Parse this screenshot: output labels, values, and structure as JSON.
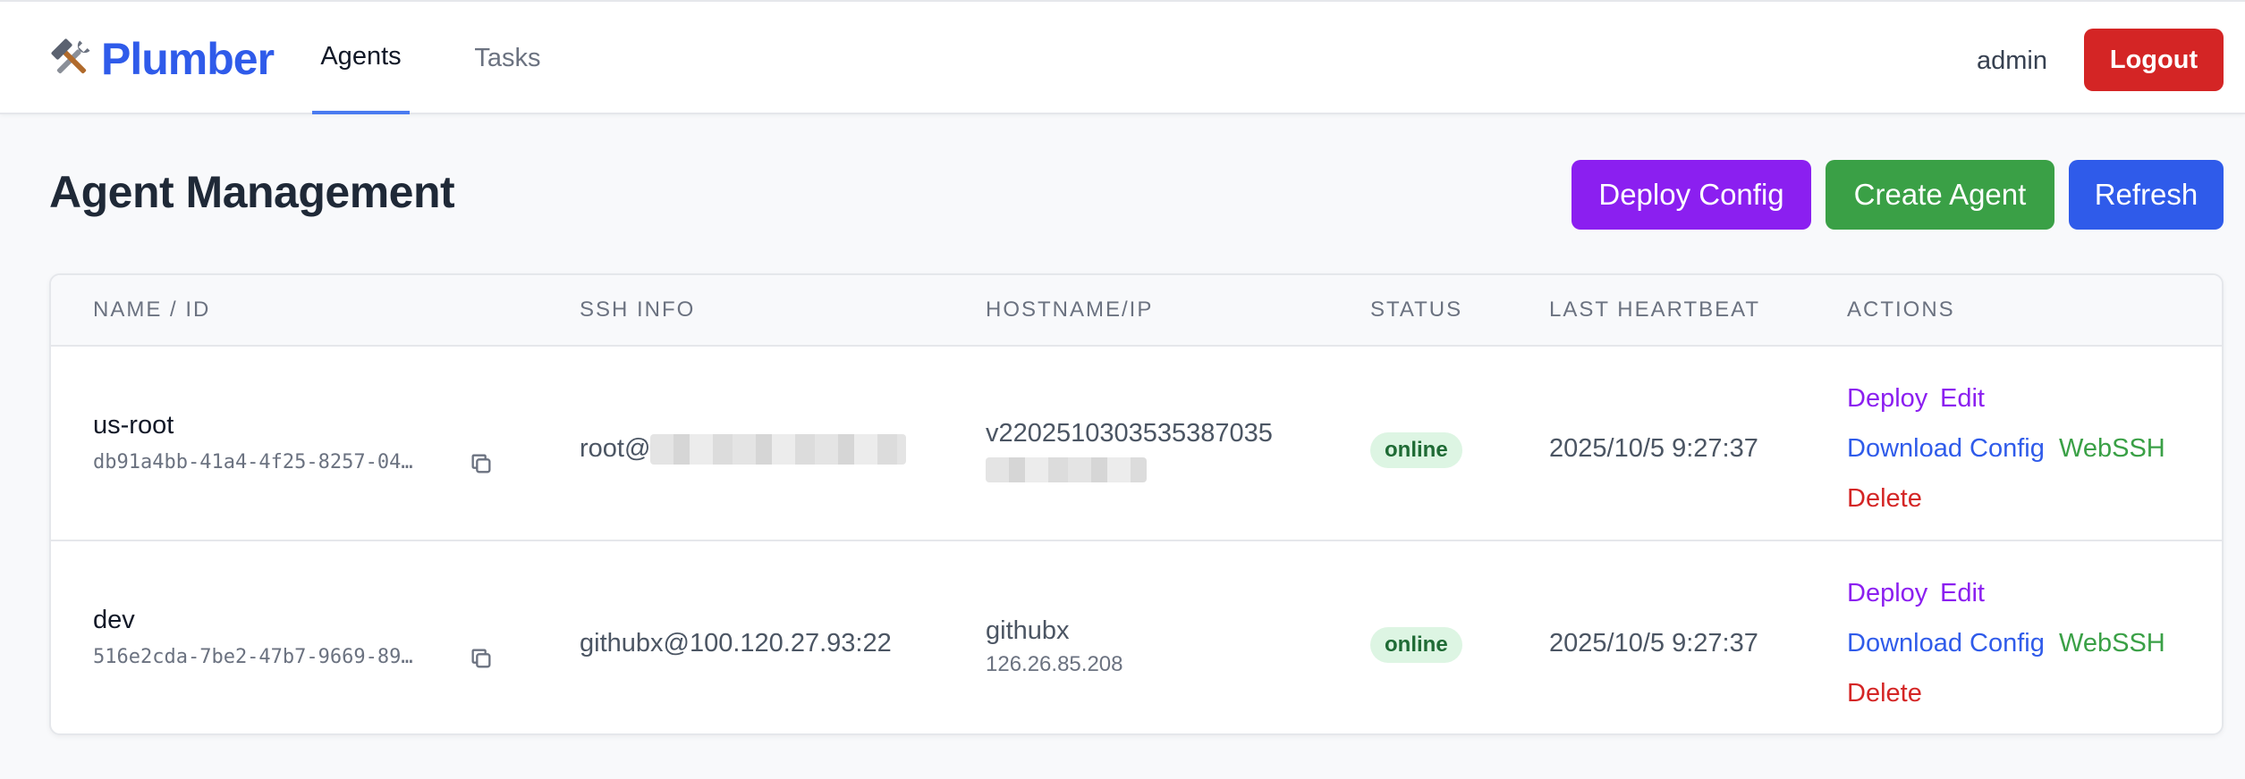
{
  "header": {
    "brand": "Plumber",
    "tabs": [
      {
        "label": "Agents",
        "active": true
      },
      {
        "label": "Tasks",
        "active": false
      }
    ],
    "username": "admin",
    "logout_label": "Logout"
  },
  "page": {
    "title": "Agent Management",
    "buttons": {
      "deploy_config": "Deploy Config",
      "create_agent": "Create Agent",
      "refresh": "Refresh"
    }
  },
  "table": {
    "columns": [
      "NAME / ID",
      "SSH INFO",
      "HOSTNAME/IP",
      "STATUS",
      "LAST HEARTBEAT",
      "ACTIONS"
    ],
    "rows": [
      {
        "name": "us-root",
        "id": "db91a4bb-41a4-4f25-8257-04…",
        "ssh": "root@",
        "hostname": "v2202510303535387035",
        "ip": "",
        "status": "online",
        "heartbeat": "2025/10/5 9:27:37",
        "actions": {
          "deploy": "Deploy",
          "edit": "Edit",
          "download_config": "Download Config",
          "webssh": "WebSSH",
          "delete": "Delete"
        }
      },
      {
        "name": "dev",
        "id": "516e2cda-7be2-47b7-9669-89…",
        "ssh": "githubx@100.120.27.93:22",
        "hostname": "githubx",
        "ip": "126.26.85.208",
        "status": "online",
        "heartbeat": "2025/10/5 9:27:37",
        "actions": {
          "deploy": "Deploy",
          "edit": "Edit",
          "download_config": "Download Config",
          "webssh": "WebSSH",
          "delete": "Delete"
        }
      }
    ]
  },
  "colors": {
    "brand": "#2f5bea",
    "logout": "#d42525",
    "deploy_config": "#8b1ff0",
    "create_agent": "#3aa046",
    "refresh": "#2f5bea",
    "status_online_bg": "#ddf5e3",
    "status_online_text": "#1f6b35"
  },
  "icons": {
    "brand": "tools-icon",
    "copy": "copy-icon"
  }
}
